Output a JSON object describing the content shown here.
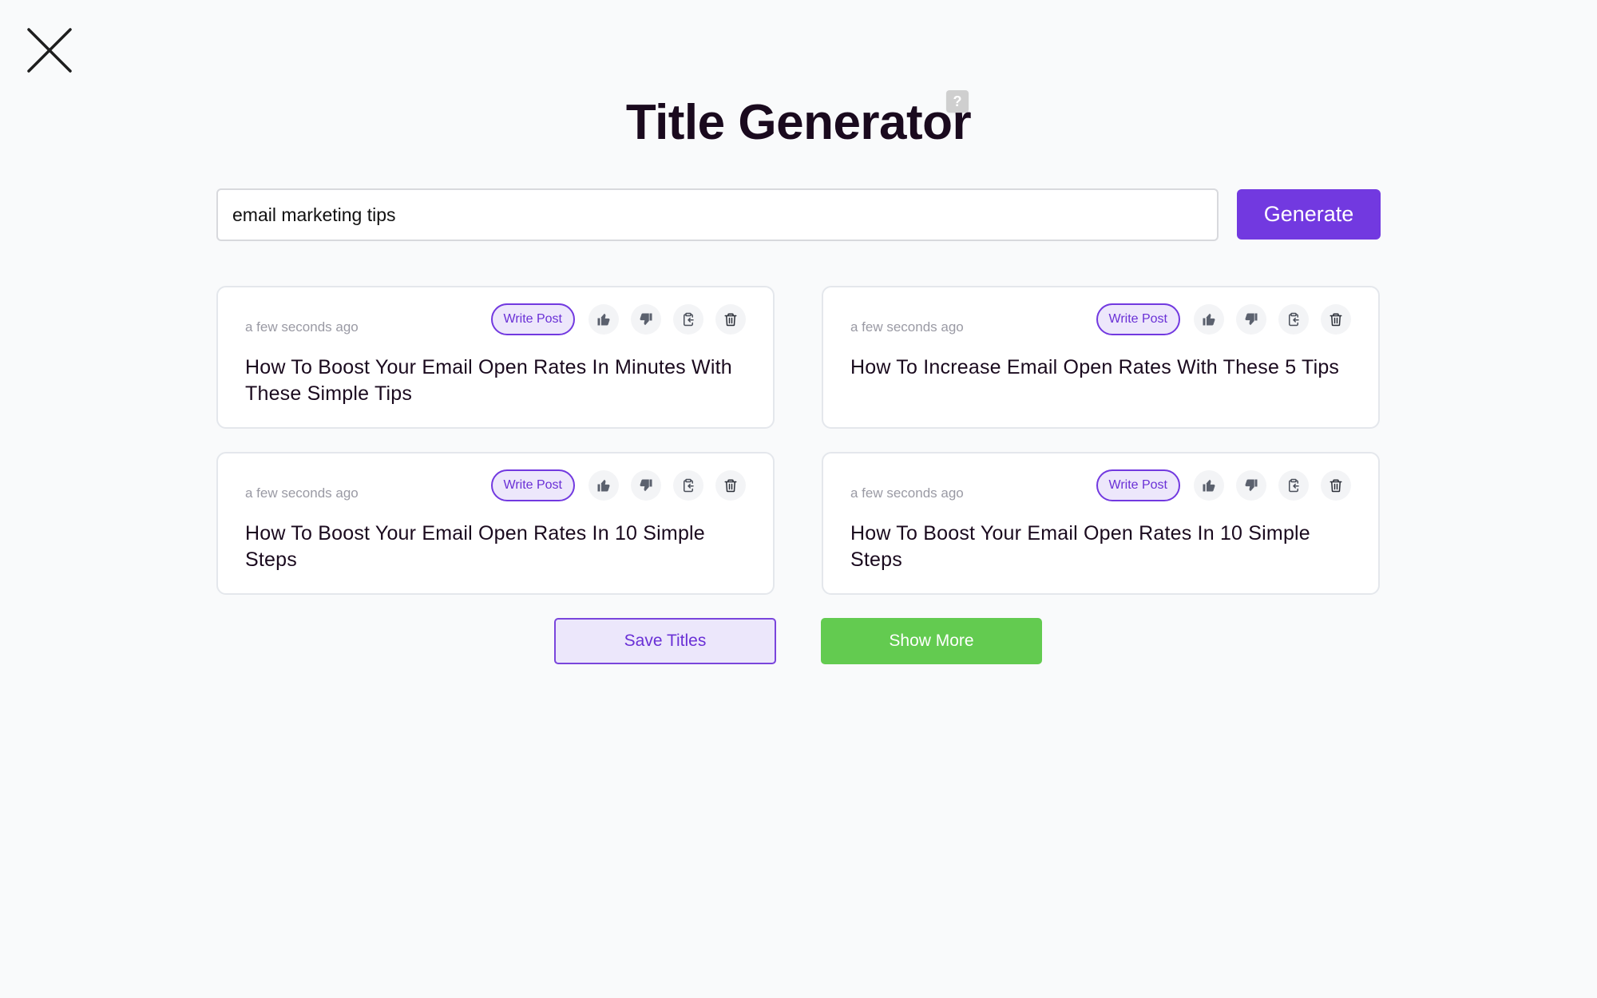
{
  "header": {
    "title": "Title Generator",
    "help_badge": "?",
    "close_icon": "close-x-icon"
  },
  "search": {
    "value": "email marketing tips",
    "placeholder": "",
    "generate_label": "Generate"
  },
  "colors": {
    "accent": "#7239e0",
    "accent_light": "#ede7fb",
    "success": "#63cb50",
    "background": "#f9fafb"
  },
  "cards": [
    {
      "timestamp": "a few seconds ago",
      "write_label": "Write Post",
      "title": "How To Boost Your Email Open Rates In Minutes With These Simple Tips",
      "icons": [
        "thumbs-up-icon",
        "thumbs-down-icon",
        "clipboard-copy-icon",
        "trash-icon"
      ]
    },
    {
      "timestamp": "a few seconds ago",
      "write_label": "Write Post",
      "title": "How To Increase Email Open Rates With These 5 Tips",
      "icons": [
        "thumbs-up-icon",
        "thumbs-down-icon",
        "clipboard-copy-icon",
        "trash-icon"
      ]
    },
    {
      "timestamp": "a few seconds ago",
      "write_label": "Write Post",
      "title": "How To Boost Your Email Open Rates In 10 Simple Steps",
      "icons": [
        "thumbs-up-icon",
        "thumbs-down-icon",
        "clipboard-copy-icon",
        "trash-icon"
      ]
    },
    {
      "timestamp": "a few seconds ago",
      "write_label": "Write Post",
      "title": "How To Boost Your Email Open Rates In 10 Simple Steps",
      "icons": [
        "thumbs-up-icon",
        "thumbs-down-icon",
        "clipboard-copy-icon",
        "trash-icon"
      ]
    }
  ],
  "footer": {
    "save_label": "Save Titles",
    "more_label": "Show More"
  }
}
